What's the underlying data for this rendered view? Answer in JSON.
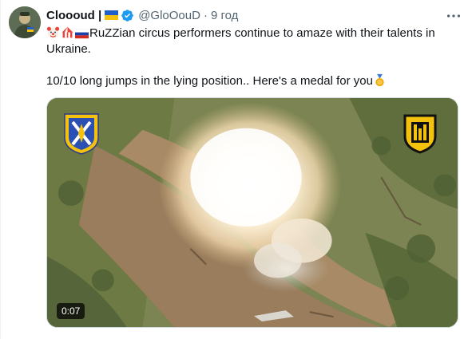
{
  "tweet": {
    "display_name": "Cloooud |",
    "handle": "@GloOouD",
    "separator": "·",
    "time": "9 год",
    "line1": "RuZZian circus performers continue to amaze with their talents in Ukraine.",
    "line2": "10/10 long jumps in the lying position.. Here's a medal for you",
    "emojis_line1": [
      "clown-face",
      "circus-tent",
      "russia-flag"
    ],
    "emoji_line2_end": "medal",
    "media": {
      "duration": "0:07"
    }
  },
  "colors": {
    "text": "#0f1419",
    "secondary": "#536471",
    "verified": "#1d9bf0",
    "ukraine_blue": "#1f5fc7",
    "ukraine_yellow": "#f4c20d"
  }
}
